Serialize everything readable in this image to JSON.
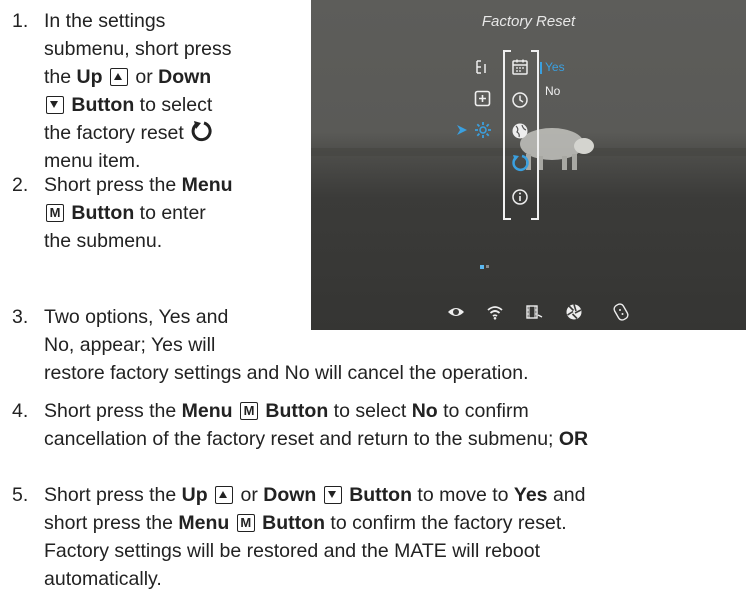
{
  "steps": [
    {
      "num": "1.",
      "l1": "In the settings",
      "l2": "submenu, short press",
      "l3_a": "the",
      "l3_b": "Up",
      "l3_c": "or",
      "l3_d": "Down",
      "l4_b": "Button",
      "l4_c": "to select",
      "l5": "the factory reset",
      "l6": "menu item."
    },
    {
      "num": "2.",
      "l1_a": "Short press the",
      "l1_b": "Menu",
      "l2_b": "Button",
      "l2_c": "to enter",
      "l3": "the submenu."
    },
    {
      "num": "3.",
      "l1": "Two options, Yes and",
      "l2": "No, appear; Yes will",
      "l3": "restore factory settings and No will cancel the operation."
    },
    {
      "num": "4.",
      "l1_a": "Short press the",
      "l1_b": "Menu",
      "l1_c": "Button",
      "l1_d": "to select",
      "l1_e": "No",
      "l1_f": "to confirm",
      "l2_a": "cancellation of the factory reset and return to the submenu;",
      "l2_b": "OR"
    },
    {
      "num": "5.",
      "l1_a": "Short press the",
      "l1_b": "Up",
      "l1_c": "or",
      "l1_d": "Down",
      "l1_e": "Button",
      "l1_f": "to move to",
      "l1_g": "Yes",
      "l1_h": "and",
      "l2_a": "short press the",
      "l2_b": "Menu",
      "l2_c": "Button",
      "l2_d": "to confirm the factory reset.",
      "l3": "Factory settings will be restored and the MATE will reboot",
      "l4": "automatically."
    }
  ],
  "key_m": "M",
  "screen": {
    "title": "Factory Reset",
    "opt_yes": "Yes",
    "opt_no": "No",
    "accent": "#3aa0e0",
    "icons": [
      "ruler-icon",
      "plus-square-icon",
      "gear-icon",
      "calendar-icon",
      "clock-icon",
      "globe-icon",
      "reset-icon",
      "info-icon"
    ],
    "bottom_icons": [
      "eye-icon",
      "wifi-icon",
      "video-icon",
      "aperture-icon",
      "remote-icon"
    ]
  }
}
